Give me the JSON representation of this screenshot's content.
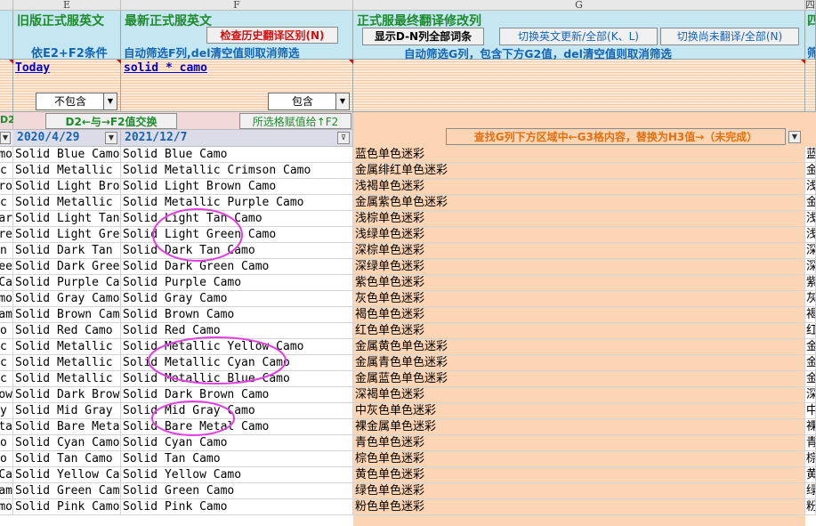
{
  "columns": {
    "e": "E",
    "f": "F",
    "g": "G",
    "h": "四"
  },
  "header": {
    "e_title": "旧版正式服英文",
    "e_sub": "依E2+F2条件",
    "f_title": "最新正式服英文",
    "f_btn": "检查历史翻译区别(N)",
    "f_sub": "自动筛选F列,del清空值则取消筛选",
    "g_title": "正式服最终翻译修改列",
    "g_btn1": "显示D-N列全部词条",
    "g_btn2": "切换英文更新/全部(K、L)",
    "g_btn3": "切换尚未翻译/全部(N)",
    "g_sub": "自动筛选G列，包含下方G2值，del清空值则取消筛选",
    "h_title": "四",
    "h_sub": "筛"
  },
  "filters": {
    "e_value": "Today",
    "f_value": "solid * camo",
    "e_dropdown": "不包含",
    "f_dropdown": "包含"
  },
  "row3": {
    "d_label": "D2",
    "swap_btn": "D2←与→F2值交换",
    "assign_btn": "所选格赋值给↑F2",
    "g_banner": "查找G列下方区域中←G3格内容，替换为H3值→（未完成）"
  },
  "dates": {
    "e": "2020/4/29",
    "f": "2021/12/7"
  },
  "rows": [
    {
      "d": "mo",
      "e": "Solid Blue Camo",
      "f": "Solid Blue Camo",
      "g": "蓝色单色迷彩",
      "h": "蓝"
    },
    {
      "d": "c",
      "e": "Solid Metallic",
      "f": "Solid Metallic Crimson Camo",
      "g": "金属绯红单色迷彩",
      "h": "金"
    },
    {
      "d": "ro",
      "e": "Solid Light Bro",
      "f": "Solid Light Brown Camo",
      "g": "浅褐单色迷彩",
      "h": "浅"
    },
    {
      "d": "c",
      "e": "Solid Metallic",
      "f": "Solid Metallic Purple Camo",
      "g": "金属紫色单色迷彩",
      "h": "金"
    },
    {
      "d": "ar",
      "e": "Solid Light Tan",
      "f": "Solid Light Tan Camo",
      "g": "浅棕单色迷彩",
      "h": "浅"
    },
    {
      "d": "re",
      "e": "Solid Light Gre",
      "f": "Solid Light Green Camo",
      "g": "浅绿单色迷彩",
      "h": "浅"
    },
    {
      "d": "n",
      "e": "Solid Dark Tan",
      "f": "Solid Dark Tan Camo",
      "g": "深棕单色迷彩",
      "h": "深"
    },
    {
      "d": "ee",
      "e": "Solid Dark Gree",
      "f": "Solid Dark Green Camo",
      "g": "深绿单色迷彩",
      "h": "深"
    },
    {
      "d": "Ca",
      "e": "Solid Purple Ca",
      "f": "Solid Purple Camo",
      "g": "紫色单色迷彩",
      "h": "紫"
    },
    {
      "d": "mo",
      "e": "Solid Gray Camo",
      "f": "Solid Gray Camo",
      "g": "灰色单色迷彩",
      "h": "灰"
    },
    {
      "d": "am",
      "e": "Solid Brown Cam",
      "f": "Solid Brown Camo",
      "g": "褐色单色迷彩",
      "h": "褐"
    },
    {
      "d": "o",
      "e": "Solid Red Camo",
      "f": "Solid Red Camo",
      "g": "红色单色迷彩",
      "h": "红"
    },
    {
      "d": "c",
      "e": "Solid Metallic",
      "f": "Solid Metallic Yellow Camo",
      "g": "金属黄色单色迷彩",
      "h": "金"
    },
    {
      "d": "c",
      "e": "Solid Metallic",
      "f": "Solid Metallic Cyan Camo",
      "g": "金属青色单色迷彩",
      "h": "金"
    },
    {
      "d": "c",
      "e": "Solid Metallic",
      "f": "Solid Metallic Blue Camo",
      "g": "金属蓝色单色迷彩",
      "h": "金"
    },
    {
      "d": "ow",
      "e": "Solid Dark Brow",
      "f": "Solid Dark Brown Camo",
      "g": "深褐单色迷彩",
      "h": "深"
    },
    {
      "d": "y",
      "e": "Solid Mid Gray",
      "f": "Solid Mid Gray Camo",
      "g": "中灰色单色迷彩",
      "h": "中"
    },
    {
      "d": "ta",
      "e": "Solid Bare Meta",
      "f": "Solid Bare Metal Camo",
      "g": "裸金属单色迷彩",
      "h": "裸"
    },
    {
      "d": "o",
      "e": "Solid Cyan Camo",
      "f": "Solid Cyan Camo",
      "g": "青色单色迷彩",
      "h": "青"
    },
    {
      "d": "o",
      "e": "Solid Tan Camo",
      "f": "Solid Tan Camo",
      "g": "棕色单色迷彩",
      "h": "棕"
    },
    {
      "d": "Ca",
      "e": "Solid Yellow Ca",
      "f": "Solid Yellow Camo",
      "g": "黄色单色迷彩",
      "h": "黄"
    },
    {
      "d": "am",
      "e": "Solid Green Cam",
      "f": "Solid Green Camo",
      "g": "绿色单色迷彩",
      "h": "绿"
    },
    {
      "d": "mo",
      "e": "Solid Pink Camo",
      "f": "Solid Pink Camo",
      "g": "粉色单色迷彩",
      "h": "粉"
    }
  ],
  "colors": {
    "header_bg": "#c5e7f1",
    "green_text": "#1f8a2c",
    "blue_text": "#1464b4",
    "red_text": "#d01010",
    "peach": "#fcd5b4",
    "annotation": "#e040e0"
  },
  "icons": {
    "dropdown": "triangle-down",
    "filter": "funnel"
  }
}
